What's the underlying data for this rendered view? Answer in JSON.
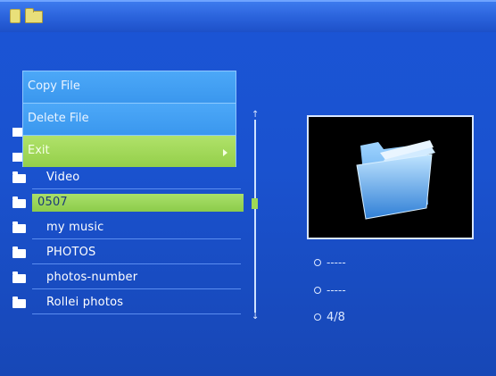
{
  "status_bar": {
    "icons": [
      "memory-card-icon",
      "folder-icon"
    ]
  },
  "popup_menu": {
    "items": [
      {
        "label": "Copy File"
      },
      {
        "label": "Delete File"
      },
      {
        "label": "Exit"
      }
    ]
  },
  "file_list": {
    "items": [
      {
        "label": "Video"
      },
      {
        "label": "0507",
        "selected": true
      },
      {
        "label": "my music"
      },
      {
        "label": "PHOTOS"
      },
      {
        "label": "photos-number"
      },
      {
        "label": "Rollei photos"
      }
    ]
  },
  "info": {
    "line1": "-----",
    "line2": "-----",
    "line3": "4/8"
  },
  "colors": {
    "background": "#1a52cf",
    "highlight": "#94cf4a",
    "menu": "#3a97ee"
  }
}
